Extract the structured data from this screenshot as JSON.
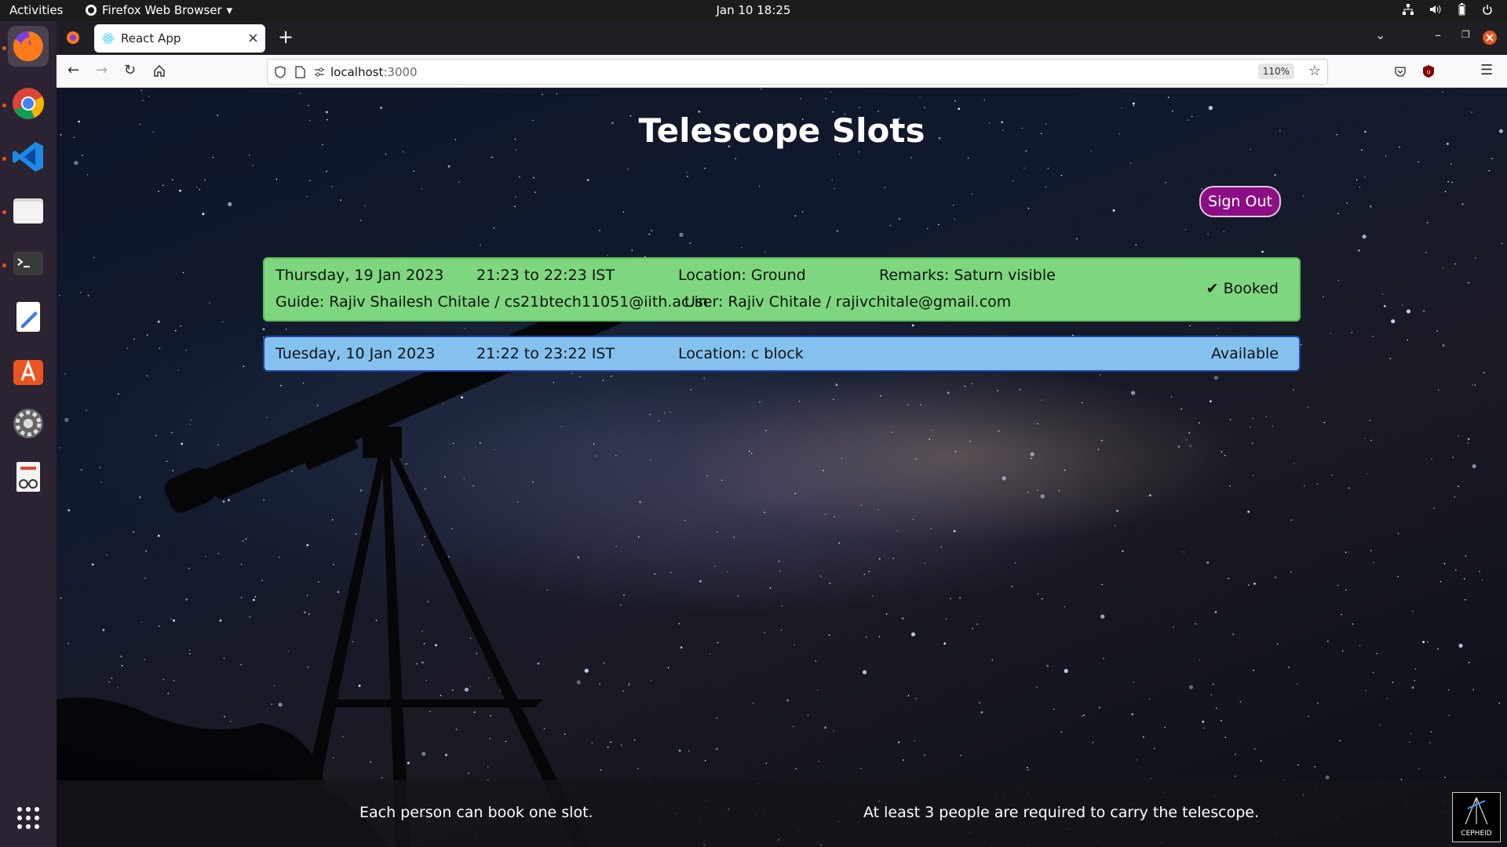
{
  "system_bar": {
    "activities": "Activities",
    "app_name": "Firefox Web Browser",
    "clock": "Jan 10  18:25"
  },
  "dock": {
    "apps": [
      "firefox-icon",
      "chrome-icon",
      "vscode-icon",
      "files-icon",
      "terminal-icon",
      "text-editor-icon",
      "app-store-icon",
      "settings-icon",
      "document-viewer-icon"
    ],
    "show_apps_icon": "grid-icon"
  },
  "browser": {
    "tab_title": "React App",
    "url_host": "localhost",
    "url_port": ":3000",
    "zoom": "110%"
  },
  "page": {
    "title": "Telescope Slots",
    "sign_out_label": "Sign Out",
    "slots": [
      {
        "date": "Thursday, 19 Jan 2023",
        "time": "21:23 to 22:23 IST",
        "location": "Location: Ground",
        "remarks": "Remarks: Saturn visible",
        "guide": "Guide: Rajiv Shailesh Chitale / cs21btech11051@iith.ac.in",
        "user": "User: Rajiv Chitale / rajivchitale@gmail.com",
        "status": "✔ Booked",
        "color": "#7ed77e"
      },
      {
        "date": "Tuesday, 10 Jan 2023",
        "time": "21:22 to 23:22 IST",
        "location": "Location: c block",
        "status": "Available",
        "color": "#84c1ef"
      }
    ],
    "footer_note_left": "Each person can book one slot.",
    "footer_note_right": "At least 3 people are required to carry the telescope.",
    "logo_text": "CEPHEID"
  },
  "colors": {
    "sign_out_bg": "#8b0e85",
    "booked": "#7ed77e",
    "available": "#84c1ef"
  }
}
